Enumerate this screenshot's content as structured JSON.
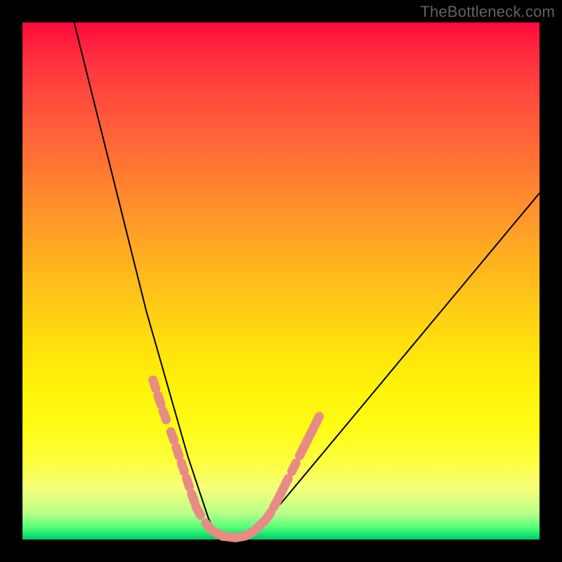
{
  "watermark": "TheBottleneck.com",
  "colors": {
    "frame_bg": "#000000",
    "gradient_top": "#ff0a3a",
    "gradient_mid": "#ffe015",
    "gradient_bottom": "#00c86a",
    "curve": "#000000",
    "markers": "#e88b84"
  },
  "chart_data": {
    "type": "line",
    "title": "",
    "xlabel": "",
    "ylabel": "",
    "xlim": [
      0,
      100
    ],
    "ylim": [
      0,
      100
    ],
    "grid": false,
    "legend": false,
    "note": "No axis ticks or labels are rendered in the image; x and y are normalized 0–100 over the plot area. y=0 is the bottom (green) edge, y=100 is the top (red) edge.",
    "series": [
      {
        "name": "curve",
        "x": [
          10,
          12,
          14,
          16,
          18,
          20,
          22,
          24,
          26,
          28,
          30,
          32,
          33,
          34,
          35,
          36,
          37,
          38,
          40,
          42,
          45,
          50,
          55,
          60,
          65,
          70,
          75,
          80,
          85,
          90,
          95,
          100
        ],
        "y": [
          100,
          92,
          84,
          76,
          68,
          60,
          52,
          44,
          37,
          30,
          23,
          16,
          13,
          10,
          7,
          4,
          2,
          1,
          0,
          0,
          2,
          7,
          13,
          19,
          25,
          31,
          37,
          43,
          49,
          55,
          61,
          67
        ]
      }
    ],
    "markers": {
      "shape": "rounded-bar",
      "color": "#e88b84",
      "points_xy": [
        [
          25.5,
          30
        ],
        [
          26.5,
          27
        ],
        [
          27.5,
          24
        ],
        [
          29.0,
          20
        ],
        [
          30.0,
          17
        ],
        [
          31.0,
          14
        ],
        [
          32.0,
          11
        ],
        [
          33.0,
          8
        ],
        [
          34.0,
          5.5
        ],
        [
          36.0,
          2.5
        ],
        [
          38.0,
          1.0
        ],
        [
          40.0,
          0.5
        ],
        [
          42.0,
          0.5
        ],
        [
          44.0,
          1.2
        ],
        [
          46.0,
          2.8
        ],
        [
          47.5,
          4.5
        ],
        [
          49.0,
          7.0
        ],
        [
          50.0,
          9.0
        ],
        [
          51.0,
          11.0
        ],
        [
          52.5,
          14.0
        ],
        [
          54.0,
          17.0
        ],
        [
          55.0,
          19.0
        ],
        [
          56.0,
          21.0
        ],
        [
          57.0,
          23.0
        ]
      ]
    }
  }
}
